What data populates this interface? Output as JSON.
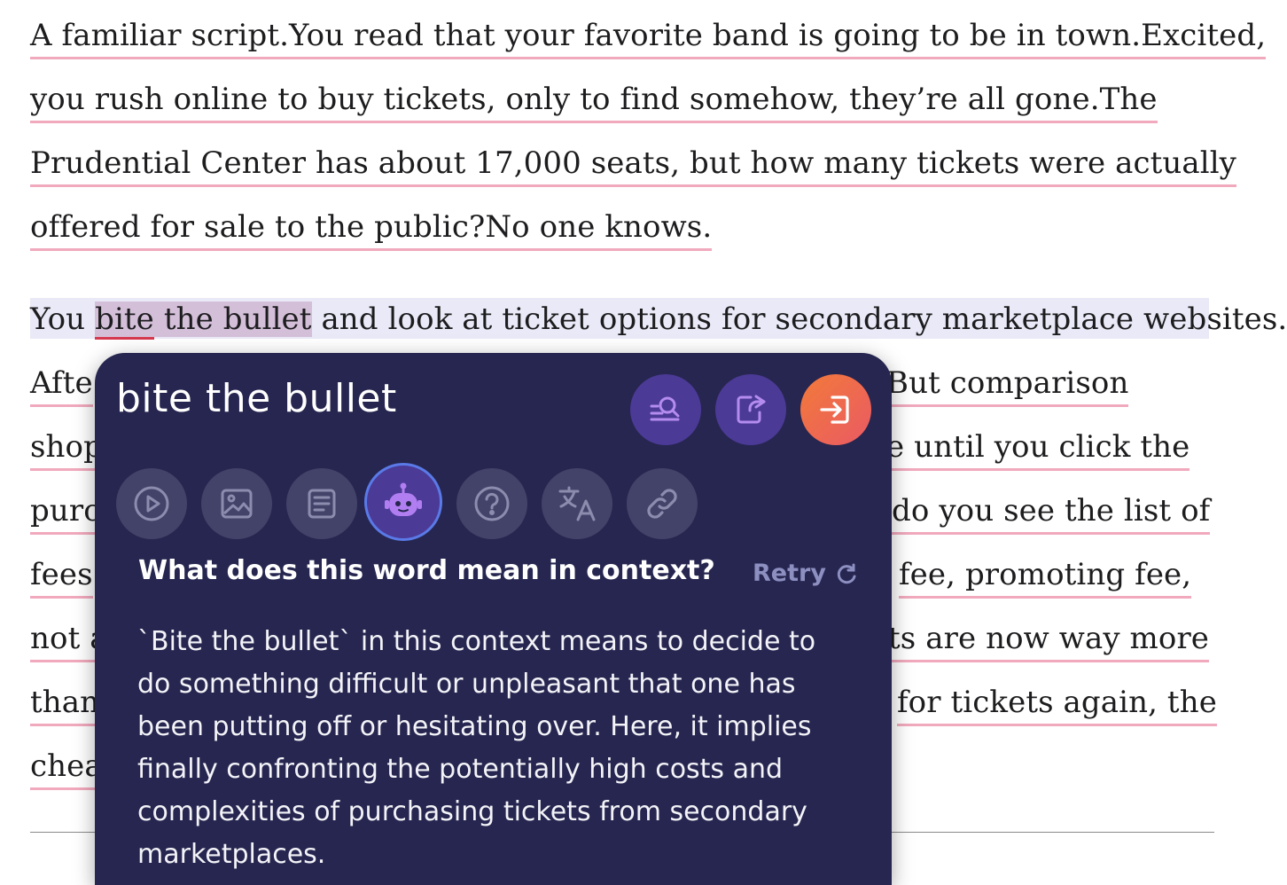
{
  "article": {
    "p1": [
      "A familiar script.You read that your favorite band is going to be in town.Excited,",
      "you rush online to buy tickets, only to find somehow, they’re all gone.The",
      "Prudential Center has about 17,000 seats, but how many tickets were actually",
      "offered for sale to the public?No one knows."
    ],
    "p2_first": {
      "before": "You ",
      "w1": "bite",
      "w2": "the",
      "w3": "bullet",
      "after": " and look at ticket options for secondary marketplace websites."
    },
    "left_fragments": [
      "Afte",
      "shop",
      "purc",
      "fees",
      "not a",
      "than",
      "chea"
    ],
    "right_fragments": [
      "But comparison",
      "e until you click the",
      "do you see the list of",
      "fee, promoting fee,",
      "ts are now way more",
      "for tickets again, the"
    ]
  },
  "popup": {
    "title": "bite the bullet",
    "question": "What does this word mean in context?",
    "retry_label": "Retry",
    "answer": "`Bite the bullet` in this context means to decide to do something difficult or unpleasant that one has been putting off or hesitating over. Here, it implies finally confronting the potentially high costs and complexities of purchasing tickets from secondary marketplaces.",
    "top_buttons": [
      "search-list-icon",
      "edit-share-icon",
      "login-icon"
    ],
    "tools": [
      "play-icon",
      "image-icon",
      "document-icon",
      "robot-icon",
      "help-icon",
      "translate-icon",
      "link-icon"
    ]
  },
  "colors": {
    "popup_bg": "#262650",
    "accent_purple": "#4b3a96",
    "orange_button": "#f27a3a",
    "active_ring": "#5a7ae8",
    "underline": "#f1a9bd"
  }
}
